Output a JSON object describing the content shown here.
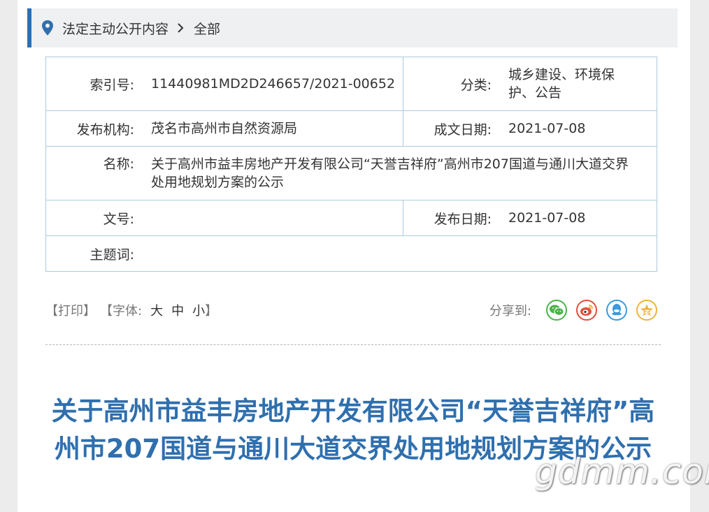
{
  "breadcrumb": {
    "section": "法定主动公开内容",
    "current": "全部"
  },
  "meta": {
    "index_no": {
      "label": "索引号:",
      "value": "11440981MD2D246657/2021-00652"
    },
    "category": {
      "label": "分类:",
      "value": "城乡建设、环境保护、公告"
    },
    "publisher": {
      "label": "发布机构:",
      "value": "茂名市高州市自然资源局"
    },
    "created_date": {
      "label": "成文日期:",
      "value": "2021-07-08"
    },
    "name": {
      "label": "名称:",
      "value": "关于高州市益丰房地产开发有限公司“天誉吉祥府”高州市207国道与通川大道交界处用地规划方案的公示"
    },
    "doc_no": {
      "label": "文号:",
      "value": ""
    },
    "publish_date": {
      "label": "发布日期:",
      "value": "2021-07-08"
    },
    "keywords": {
      "label": "主题词:",
      "value": ""
    }
  },
  "tools": {
    "print": "【打印】",
    "font_prefix": "【字体:",
    "font_large": "大",
    "font_medium": "中",
    "font_small": "小",
    "font_suffix": "】",
    "share_label": "分享到:"
  },
  "share_icons": [
    "wechat-icon",
    "weibo-icon",
    "qq-icon",
    "qzone-icon"
  ],
  "colors": {
    "accent": "#2f6fae",
    "table_border": "#a9cbe0",
    "wechat": "#4cb34a",
    "weibo": "#e0503e",
    "qq": "#3b9be0",
    "qzone": "#f0b43a"
  },
  "article": {
    "title": "关于高州市益丰房地产开发有限公司“天誉吉祥府”高州市207国道与通川大道交界处用地规划方案的公示"
  },
  "watermark": "gdmm.com"
}
